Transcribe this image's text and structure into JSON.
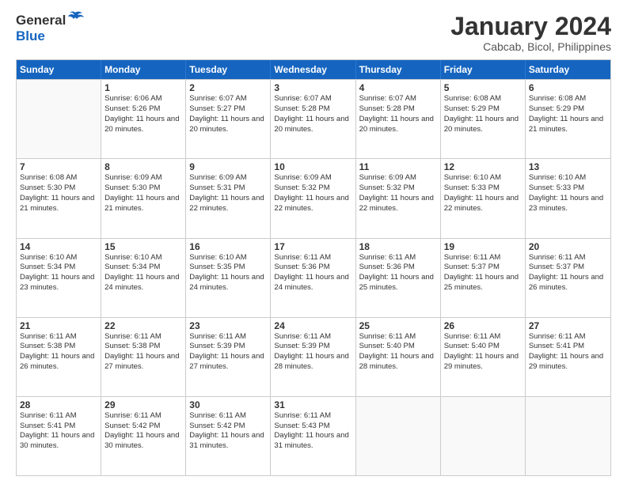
{
  "header": {
    "logo_general": "General",
    "logo_blue": "Blue",
    "month_year": "January 2024",
    "location": "Cabcab, Bicol, Philippines"
  },
  "days_of_week": [
    "Sunday",
    "Monday",
    "Tuesday",
    "Wednesday",
    "Thursday",
    "Friday",
    "Saturday"
  ],
  "weeks": [
    [
      {
        "day": "",
        "sunrise": "",
        "sunset": "",
        "daylight": ""
      },
      {
        "day": "1",
        "sunrise": "Sunrise: 6:06 AM",
        "sunset": "Sunset: 5:26 PM",
        "daylight": "Daylight: 11 hours and 20 minutes."
      },
      {
        "day": "2",
        "sunrise": "Sunrise: 6:07 AM",
        "sunset": "Sunset: 5:27 PM",
        "daylight": "Daylight: 11 hours and 20 minutes."
      },
      {
        "day": "3",
        "sunrise": "Sunrise: 6:07 AM",
        "sunset": "Sunset: 5:28 PM",
        "daylight": "Daylight: 11 hours and 20 minutes."
      },
      {
        "day": "4",
        "sunrise": "Sunrise: 6:07 AM",
        "sunset": "Sunset: 5:28 PM",
        "daylight": "Daylight: 11 hours and 20 minutes."
      },
      {
        "day": "5",
        "sunrise": "Sunrise: 6:08 AM",
        "sunset": "Sunset: 5:29 PM",
        "daylight": "Daylight: 11 hours and 20 minutes."
      },
      {
        "day": "6",
        "sunrise": "Sunrise: 6:08 AM",
        "sunset": "Sunset: 5:29 PM",
        "daylight": "Daylight: 11 hours and 21 minutes."
      }
    ],
    [
      {
        "day": "7",
        "sunrise": "Sunrise: 6:08 AM",
        "sunset": "Sunset: 5:30 PM",
        "daylight": "Daylight: 11 hours and 21 minutes."
      },
      {
        "day": "8",
        "sunrise": "Sunrise: 6:09 AM",
        "sunset": "Sunset: 5:30 PM",
        "daylight": "Daylight: 11 hours and 21 minutes."
      },
      {
        "day": "9",
        "sunrise": "Sunrise: 6:09 AM",
        "sunset": "Sunset: 5:31 PM",
        "daylight": "Daylight: 11 hours and 22 minutes."
      },
      {
        "day": "10",
        "sunrise": "Sunrise: 6:09 AM",
        "sunset": "Sunset: 5:32 PM",
        "daylight": "Daylight: 11 hours and 22 minutes."
      },
      {
        "day": "11",
        "sunrise": "Sunrise: 6:09 AM",
        "sunset": "Sunset: 5:32 PM",
        "daylight": "Daylight: 11 hours and 22 minutes."
      },
      {
        "day": "12",
        "sunrise": "Sunrise: 6:10 AM",
        "sunset": "Sunset: 5:33 PM",
        "daylight": "Daylight: 11 hours and 22 minutes."
      },
      {
        "day": "13",
        "sunrise": "Sunrise: 6:10 AM",
        "sunset": "Sunset: 5:33 PM",
        "daylight": "Daylight: 11 hours and 23 minutes."
      }
    ],
    [
      {
        "day": "14",
        "sunrise": "Sunrise: 6:10 AM",
        "sunset": "Sunset: 5:34 PM",
        "daylight": "Daylight: 11 hours and 23 minutes."
      },
      {
        "day": "15",
        "sunrise": "Sunrise: 6:10 AM",
        "sunset": "Sunset: 5:34 PM",
        "daylight": "Daylight: 11 hours and 24 minutes."
      },
      {
        "day": "16",
        "sunrise": "Sunrise: 6:10 AM",
        "sunset": "Sunset: 5:35 PM",
        "daylight": "Daylight: 11 hours and 24 minutes."
      },
      {
        "day": "17",
        "sunrise": "Sunrise: 6:11 AM",
        "sunset": "Sunset: 5:36 PM",
        "daylight": "Daylight: 11 hours and 24 minutes."
      },
      {
        "day": "18",
        "sunrise": "Sunrise: 6:11 AM",
        "sunset": "Sunset: 5:36 PM",
        "daylight": "Daylight: 11 hours and 25 minutes."
      },
      {
        "day": "19",
        "sunrise": "Sunrise: 6:11 AM",
        "sunset": "Sunset: 5:37 PM",
        "daylight": "Daylight: 11 hours and 25 minutes."
      },
      {
        "day": "20",
        "sunrise": "Sunrise: 6:11 AM",
        "sunset": "Sunset: 5:37 PM",
        "daylight": "Daylight: 11 hours and 26 minutes."
      }
    ],
    [
      {
        "day": "21",
        "sunrise": "Sunrise: 6:11 AM",
        "sunset": "Sunset: 5:38 PM",
        "daylight": "Daylight: 11 hours and 26 minutes."
      },
      {
        "day": "22",
        "sunrise": "Sunrise: 6:11 AM",
        "sunset": "Sunset: 5:38 PM",
        "daylight": "Daylight: 11 hours and 27 minutes."
      },
      {
        "day": "23",
        "sunrise": "Sunrise: 6:11 AM",
        "sunset": "Sunset: 5:39 PM",
        "daylight": "Daylight: 11 hours and 27 minutes."
      },
      {
        "day": "24",
        "sunrise": "Sunrise: 6:11 AM",
        "sunset": "Sunset: 5:39 PM",
        "daylight": "Daylight: 11 hours and 28 minutes."
      },
      {
        "day": "25",
        "sunrise": "Sunrise: 6:11 AM",
        "sunset": "Sunset: 5:40 PM",
        "daylight": "Daylight: 11 hours and 28 minutes."
      },
      {
        "day": "26",
        "sunrise": "Sunrise: 6:11 AM",
        "sunset": "Sunset: 5:40 PM",
        "daylight": "Daylight: 11 hours and 29 minutes."
      },
      {
        "day": "27",
        "sunrise": "Sunrise: 6:11 AM",
        "sunset": "Sunset: 5:41 PM",
        "daylight": "Daylight: 11 hours and 29 minutes."
      }
    ],
    [
      {
        "day": "28",
        "sunrise": "Sunrise: 6:11 AM",
        "sunset": "Sunset: 5:41 PM",
        "daylight": "Daylight: 11 hours and 30 minutes."
      },
      {
        "day": "29",
        "sunrise": "Sunrise: 6:11 AM",
        "sunset": "Sunset: 5:42 PM",
        "daylight": "Daylight: 11 hours and 30 minutes."
      },
      {
        "day": "30",
        "sunrise": "Sunrise: 6:11 AM",
        "sunset": "Sunset: 5:42 PM",
        "daylight": "Daylight: 11 hours and 31 minutes."
      },
      {
        "day": "31",
        "sunrise": "Sunrise: 6:11 AM",
        "sunset": "Sunset: 5:43 PM",
        "daylight": "Daylight: 11 hours and 31 minutes."
      },
      {
        "day": "",
        "sunrise": "",
        "sunset": "",
        "daylight": ""
      },
      {
        "day": "",
        "sunrise": "",
        "sunset": "",
        "daylight": ""
      },
      {
        "day": "",
        "sunrise": "",
        "sunset": "",
        "daylight": ""
      }
    ]
  ]
}
